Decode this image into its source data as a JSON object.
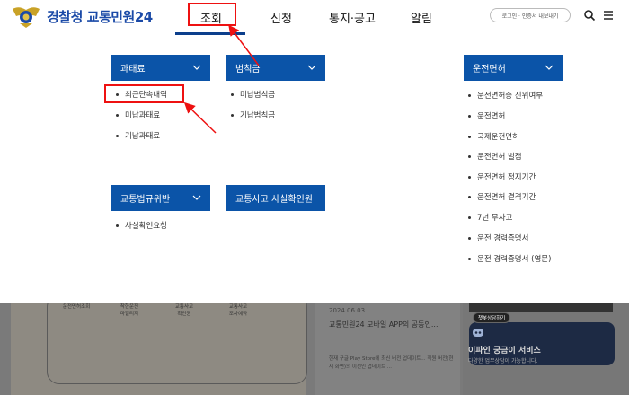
{
  "brand": {
    "name_part1": "경찰청",
    "name_part2": "교통민원24"
  },
  "gnb": [
    {
      "label": "조회"
    },
    {
      "label": "신청"
    },
    {
      "label": "통지·공고"
    },
    {
      "label": "알림"
    }
  ],
  "header": {
    "login_label": "로그인 · 인증서 내보내기"
  },
  "menu": {
    "fine": {
      "title": "과태료",
      "items": [
        "최근단속내역",
        "미납과태료",
        "기납과태료"
      ]
    },
    "penalty": {
      "title": "범칙금",
      "items": [
        "미납범칙금",
        "기납범칙금"
      ]
    },
    "violation": {
      "title": "교통법규위반",
      "items": [
        "사실확인요청"
      ]
    },
    "accident": {
      "title": "교통사고 사실확인원"
    },
    "license": {
      "title": "운전면허",
      "items": [
        "운전면허증 진위여부",
        "운전면허",
        "국제운전면허",
        "운전면허 벌점",
        "운전면허 정지기간",
        "운전면허 결격기간",
        "7년 무사고",
        "운전 경력증명서",
        "운전 경력증명서 (영문)"
      ]
    }
  },
  "background": {
    "quick_links": [
      "운전면허조회",
      "착한운전\n마일리지",
      "교통사고\n확인원",
      "교통사고\n조사예약"
    ],
    "news_date": "2024.06.03",
    "news_title": "교통민원24 모바일 APP의 공동인...",
    "news_desc": "현재 구글 Play Store에 최신 버전 업데이트... 직원 버전(현재 화면)의 이전인 업데이트 ...",
    "chat_badge": "챗봇상담하기",
    "chat_title": "이파인 궁금이 서비스",
    "chat_desc": "다양한 업무상담이 가능합니다."
  },
  "colors": {
    "brand_blue": "#0b54a8",
    "highlight_red": "#e11111"
  }
}
